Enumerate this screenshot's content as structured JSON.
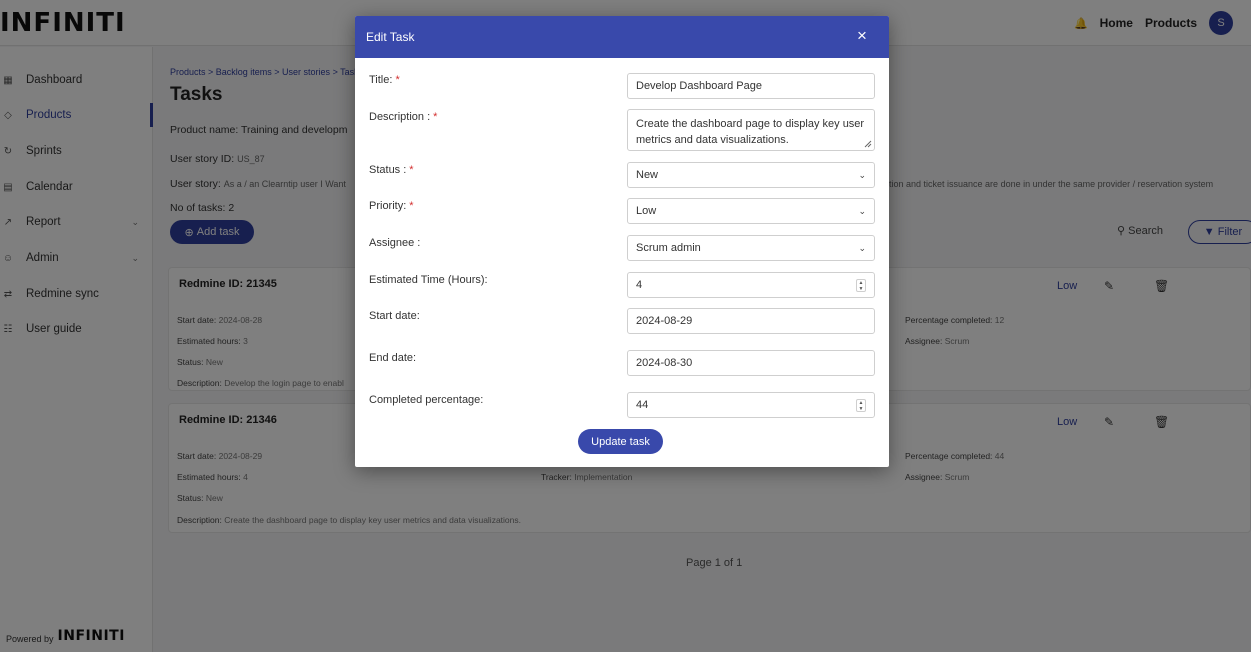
{
  "app": {
    "logo": "INFINITI"
  },
  "topnav": {
    "home": "Home",
    "products": "Products",
    "avatar_initial": "S"
  },
  "sidebar": {
    "items": [
      {
        "label": "Dashboard",
        "icon": "grid-icon"
      },
      {
        "label": "Products",
        "icon": "cube-icon"
      },
      {
        "label": "Sprints",
        "icon": "sprint-icon"
      },
      {
        "label": "Calendar",
        "icon": "calendar-icon"
      },
      {
        "label": "Report",
        "icon": "report-icon"
      },
      {
        "label": "Admin",
        "icon": "person-icon"
      },
      {
        "label": "Redmine sync",
        "icon": "sync-icon"
      },
      {
        "label": "User guide",
        "icon": "book-icon"
      }
    ],
    "powered_by": "Powered by",
    "powered_logo": "INFINITI"
  },
  "page": {
    "breadcrumb": "Products > Backlog items > User stories > Tasks",
    "title": "Tasks",
    "product_name_label": "Product name:",
    "product_name_value": "Training and developm",
    "user_story_id_label": "User story ID:",
    "user_story_id_value": "US_87",
    "user_story_label": "User story:",
    "user_story_value_left": "As a / an Clearntip user I Want",
    "user_story_value_right": "tion and ticket issuance are done in under the same provider / reservation system",
    "task_count_label": "No of tasks: 2",
    "add_task": "Add task",
    "search": "Search",
    "filter": "Filter",
    "pager": "Page 1 of 1"
  },
  "cards": [
    {
      "redmine_id": "Redmine ID: 21345",
      "priority": "Low",
      "start_label": "Start date:",
      "start_value": "2024-08-28",
      "hours_label": "Estimated hours:",
      "hours_value": "3",
      "status_label": "Status:",
      "status_value": "New",
      "desc_label": "Description:",
      "desc_value": "Develop the login page to enabl",
      "tracker_label": "",
      "tracker_value": "",
      "pct_label": "Percentage completed:",
      "pct_value": "12",
      "assignee_label": "Assignee:",
      "assignee_value": "Scrum"
    },
    {
      "redmine_id": "Redmine ID: 21346",
      "priority": "Low",
      "start_label": "Start date:",
      "start_value": "2024-08-29",
      "hours_label": "Estimated hours:",
      "hours_value": "4",
      "status_label": "Status:",
      "status_value": "New",
      "desc_label": "Description:",
      "desc_value": "Create the dashboard page to display key user metrics and data visualizations.",
      "tracker_label": "Tracker:",
      "tracker_value": "Implementation",
      "pct_label": "Percentage completed:",
      "pct_value": "44",
      "assignee_label": "Assignee:",
      "assignee_value": "Scrum"
    }
  ],
  "modal": {
    "title": "Edit Task",
    "close": "×",
    "fields": {
      "title_label": "Title:",
      "title_value": "Develop Dashboard Page",
      "description_label": "Description :",
      "description_value": "Create the dashboard page to display key user metrics and data visualizations.",
      "status_label": "Status :",
      "status_value": "New",
      "priority_label": "Priority:",
      "priority_value": "Low",
      "assignee_label": "Assignee :",
      "assignee_value": "Scrum admin",
      "estimated_label": "Estimated Time (Hours):",
      "estimated_value": "4",
      "start_label": "Start date:",
      "start_value": "2024-08-29",
      "end_label": "End date:",
      "end_value": "2024-08-30",
      "completed_label": "Completed percentage:",
      "completed_value": "44"
    },
    "required_mark": "*",
    "submit": "Update task"
  },
  "colors": {
    "primary": "#3949ab",
    "required": "#d32f2f"
  }
}
